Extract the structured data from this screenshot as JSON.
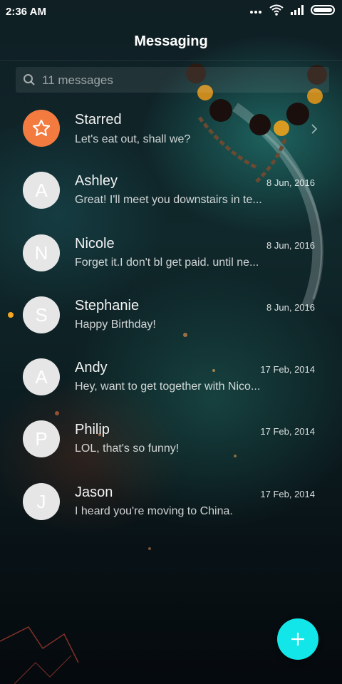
{
  "status_bar": {
    "time": "2:36 AM",
    "icons": [
      "signal-dots-icon",
      "wifi-icon",
      "cellular-signal-icon",
      "battery-icon"
    ]
  },
  "app_bar": {
    "title": "Messaging"
  },
  "search": {
    "placeholder": "11 messages",
    "icon": "search-icon"
  },
  "conversations": [
    {
      "name": "Starred",
      "preview": "Let's eat out, shall we?",
      "date": "",
      "avatar_letter": "",
      "avatar_icon": "star-icon",
      "avatar_color": "#f47b40",
      "unread": false,
      "has_chevron": true
    },
    {
      "name": "Ashley",
      "preview": "Great! I'll meet you downstairs in te...",
      "date": "8 Jun, 2016",
      "avatar_letter": "A",
      "unread": false
    },
    {
      "name": "Nicole",
      "preview": "Forget it.I don't bl get paid. until ne...",
      "date": "8 Jun, 2016",
      "avatar_letter": "N",
      "unread": false
    },
    {
      "name": "Stephanie",
      "preview": "Happy Birthday!",
      "date": "8 Jun, 2016",
      "avatar_letter": "S",
      "unread": true
    },
    {
      "name": "Andy",
      "preview": "Hey, want to get together with Nico...",
      "date": "17 Feb, 2014",
      "avatar_letter": "A",
      "unread": false
    },
    {
      "name": "Philip",
      "preview": "LOL, that's so funny!",
      "date": "17 Feb, 2014",
      "avatar_letter": "P",
      "unread": false
    },
    {
      "name": "Jason",
      "preview": "I heard you're moving to China.",
      "date": "17 Feb, 2014",
      "avatar_letter": "J",
      "unread": false
    }
  ],
  "colors": {
    "accent_fab": "#13e6e8",
    "starred_avatar": "#f47b40",
    "unread_dot": "#f5a623",
    "avatar_default": "#e6e6e6"
  },
  "fab": {
    "icon": "plus-icon"
  }
}
